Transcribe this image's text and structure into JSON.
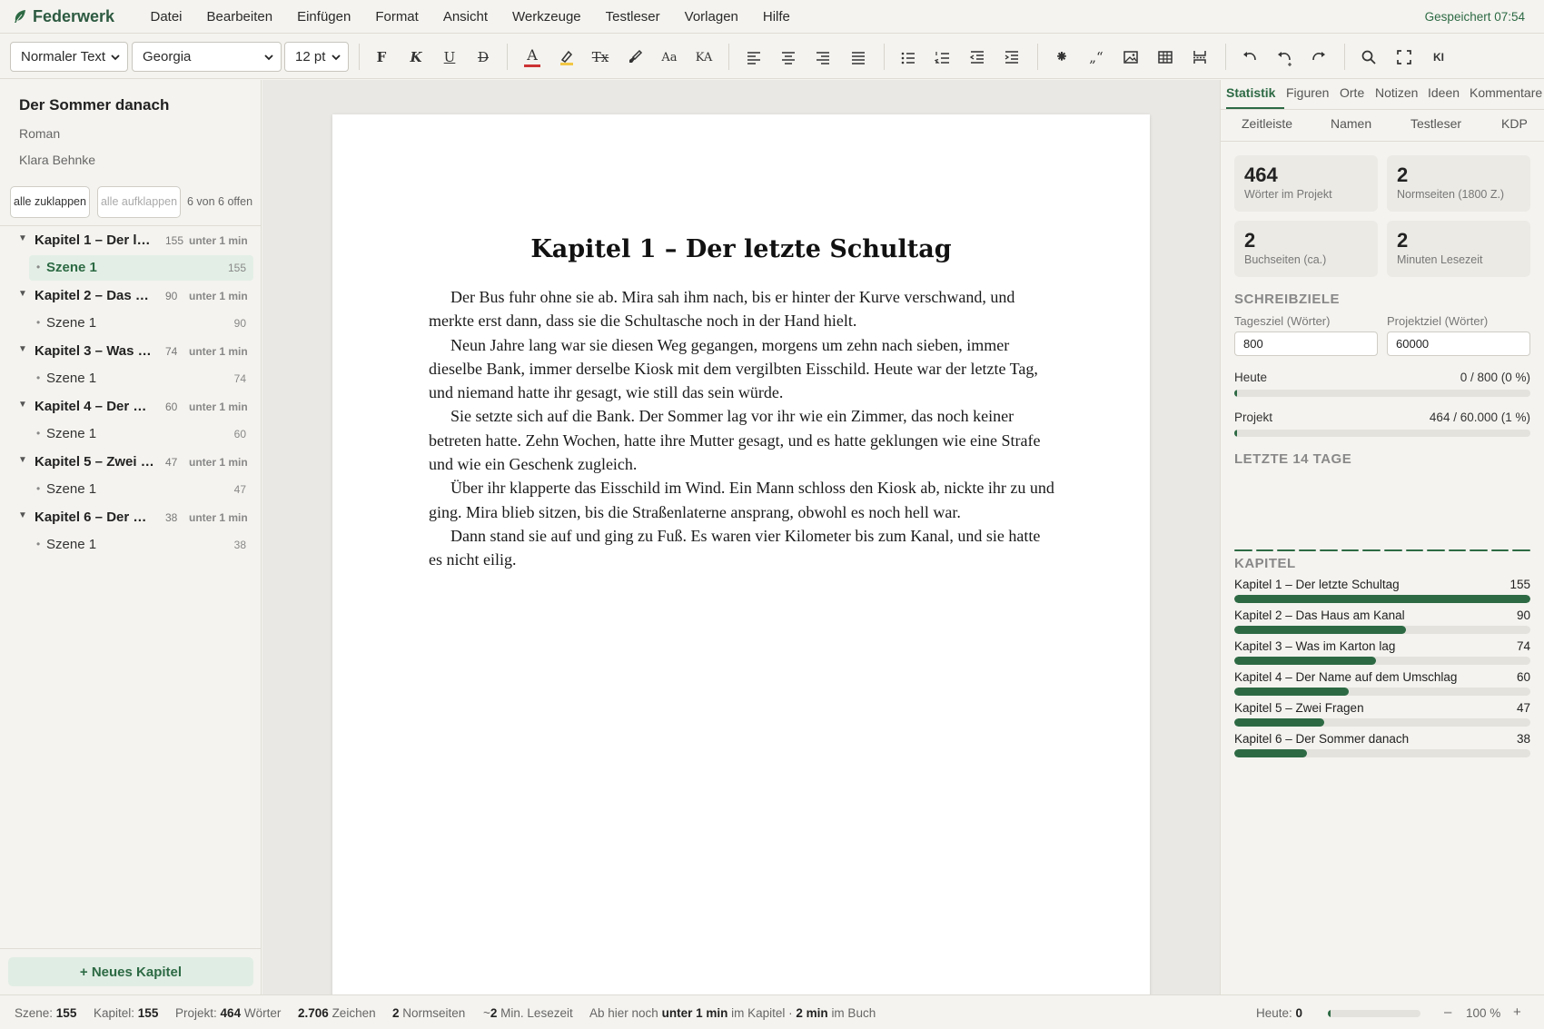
{
  "app": {
    "name": "Federwerk",
    "saved_status": "Gespeichert 07:54"
  },
  "menu": [
    "Datei",
    "Bearbeiten",
    "Einfügen",
    "Format",
    "Ansicht",
    "Werkzeuge",
    "Testleser",
    "Vorlagen",
    "Hilfe"
  ],
  "toolbar": {
    "style_select": "Normaler Text",
    "font_select": "Georgia",
    "size_select": "12 pt",
    "bold_label": "F",
    "italic_label": "K",
    "underline_label": "U",
    "strike_label": "D",
    "textcolor_label": "A",
    "clear_label": "Tx",
    "case_label": "Aa",
    "smallcaps_label": "KA",
    "scenebreak_label": "⁕",
    "quotes_label": "„“",
    "ai_label": "KI",
    "colors": {
      "text_color": "#cc3333",
      "highlight": "#f2c744"
    }
  },
  "sidebar": {
    "project_title": "Der Sommer danach",
    "genre": "Roman",
    "author": "Klara Behnke",
    "collapse_all": "alle zuklappen",
    "expand_all": "alle aufklappen",
    "open_count": "6 von 6 offen",
    "chapters": [
      {
        "title": "Kapitel 1 – Der letzte Schultag",
        "words": "155",
        "time": "unter 1 min",
        "scene": {
          "title": "Szene 1",
          "words": "155"
        }
      },
      {
        "title": "Kapitel 2 – Das Haus am Kanal",
        "words": "90",
        "time": "unter 1 min",
        "scene": {
          "title": "Szene 1",
          "words": "90"
        }
      },
      {
        "title": "Kapitel 3 – Was im Karton lag",
        "words": "74",
        "time": "unter 1 min",
        "scene": {
          "title": "Szene 1",
          "words": "74"
        }
      },
      {
        "title": "Kapitel 4 – Der Name auf dem Umschlag",
        "words": "60",
        "time": "unter 1 min",
        "scene": {
          "title": "Szene 1",
          "words": "60"
        }
      },
      {
        "title": "Kapitel 5 – Zwei Fragen",
        "words": "47",
        "time": "unter 1 min",
        "scene": {
          "title": "Szene 1",
          "words": "47"
        }
      },
      {
        "title": "Kapitel 6 – Der Sommer danach",
        "words": "38",
        "time": "unter 1 min",
        "scene": {
          "title": "Szene 1",
          "words": "38"
        }
      }
    ],
    "new_chapter": "+ Neues Kapitel"
  },
  "document": {
    "heading": "Kapitel 1 – Der letzte Schultag",
    "paragraphs": [
      "Der Bus fuhr ohne sie ab. Mira sah ihm nach, bis er hinter der Kurve verschwand, und merkte erst dann, dass sie die Schultasche noch in der Hand hielt.",
      "Neun Jahre lang war sie diesen Weg gegangen, morgens um zehn nach sieben, immer dieselbe Bank, immer derselbe Kiosk mit dem vergilbten Eisschild. Heute war der letzte Tag, und niemand hatte ihr gesagt, wie still das sein würde.",
      "Sie setzte sich auf die Bank. Der Sommer lag vor ihr wie ein Zimmer, das noch keiner betreten hatte. Zehn Wochen, hatte ihre Mutter gesagt, und es hatte geklungen wie eine Strafe und wie ein Geschenk zugleich.",
      "Über ihr klapperte das Eisschild im Wind. Ein Mann schloss den Kiosk ab, nickte ihr zu und ging. Mira blieb sitzen, bis die Straßenlaterne ansprang, obwohl es noch hell war.",
      "Dann stand sie auf und ging zu Fuß. Es waren vier Kilometer bis zum Kanal, und sie hatte es nicht eilig."
    ]
  },
  "panel": {
    "tabs": [
      "Statistik",
      "Figuren",
      "Orte",
      "Notizen",
      "Ideen",
      "Kommentare"
    ],
    "tabs2": [
      "Zeitleiste",
      "Namen",
      "Testleser",
      "KDP"
    ],
    "stats": [
      {
        "value": "464",
        "label": "Wörter im Projekt"
      },
      {
        "value": "2",
        "label": "Normseiten (1800 Z.)"
      },
      {
        "value": "2",
        "label": "Buchseiten (ca.)"
      },
      {
        "value": "2",
        "label": "Minuten Lesezeit"
      }
    ],
    "goals_heading": "SCHREIBZIELE",
    "daily_goal_label": "Tagesziel (Wörter)",
    "daily_goal_value": "800",
    "project_goal_label": "Projektziel (Wörter)",
    "project_goal_value": "60000",
    "today_label": "Heute",
    "today_value": "0 / 800 (0 %)",
    "today_progress": 0,
    "project_label": "Projekt",
    "project_value": "464 / 60.000 (1 %)",
    "project_progress": 0.0077,
    "last14_heading": "LETZTE 14 TAGE",
    "last14_values": [
      0,
      0,
      0,
      0,
      0,
      0,
      0,
      0,
      0,
      0,
      0,
      0,
      0,
      0
    ],
    "chapters_heading": "KAPITEL",
    "chapter_bars": [
      {
        "title": "Kapitel 1 – Der letzte Schultag",
        "value": "155",
        "n": 155
      },
      {
        "title": "Kapitel 2 – Das Haus am Kanal",
        "value": "90",
        "n": 90
      },
      {
        "title": "Kapitel 3 – Was im Karton lag",
        "value": "74",
        "n": 74
      },
      {
        "title": "Kapitel 4 – Der Name auf dem Umschlag",
        "value": "60",
        "n": 60
      },
      {
        "title": "Kapitel 5 – Zwei Fragen",
        "value": "47",
        "n": 47
      },
      {
        "title": "Kapitel 6 – Der Sommer danach",
        "value": "38",
        "n": 38
      }
    ]
  },
  "status": {
    "scene_label": "Szene:",
    "scene_value": "155",
    "chapter_label": "Kapitel:",
    "chapter_value": "155",
    "project_label": "Projekt:",
    "project_value": "464",
    "project_unit": "Wörter",
    "chars_value": "2.706",
    "chars_unit": "Zeichen",
    "normpages_value": "2",
    "normpages_unit": "Normseiten",
    "reading_prefix": "~",
    "reading_value": "2",
    "reading_unit": "Min. Lesezeit",
    "remaining_prefix": "Ab hier noch",
    "remaining_chapter": "unter 1 min",
    "remaining_mid": "im Kapitel ·",
    "remaining_book": "2 min",
    "remaining_suffix": "im Buch",
    "today_label": "Heute:",
    "today_value": "0",
    "today_progress": 0.02,
    "zoom_minus": "–",
    "zoom_value": "100 %",
    "zoom_plus": "+"
  },
  "accent_color": "#2d6a44"
}
